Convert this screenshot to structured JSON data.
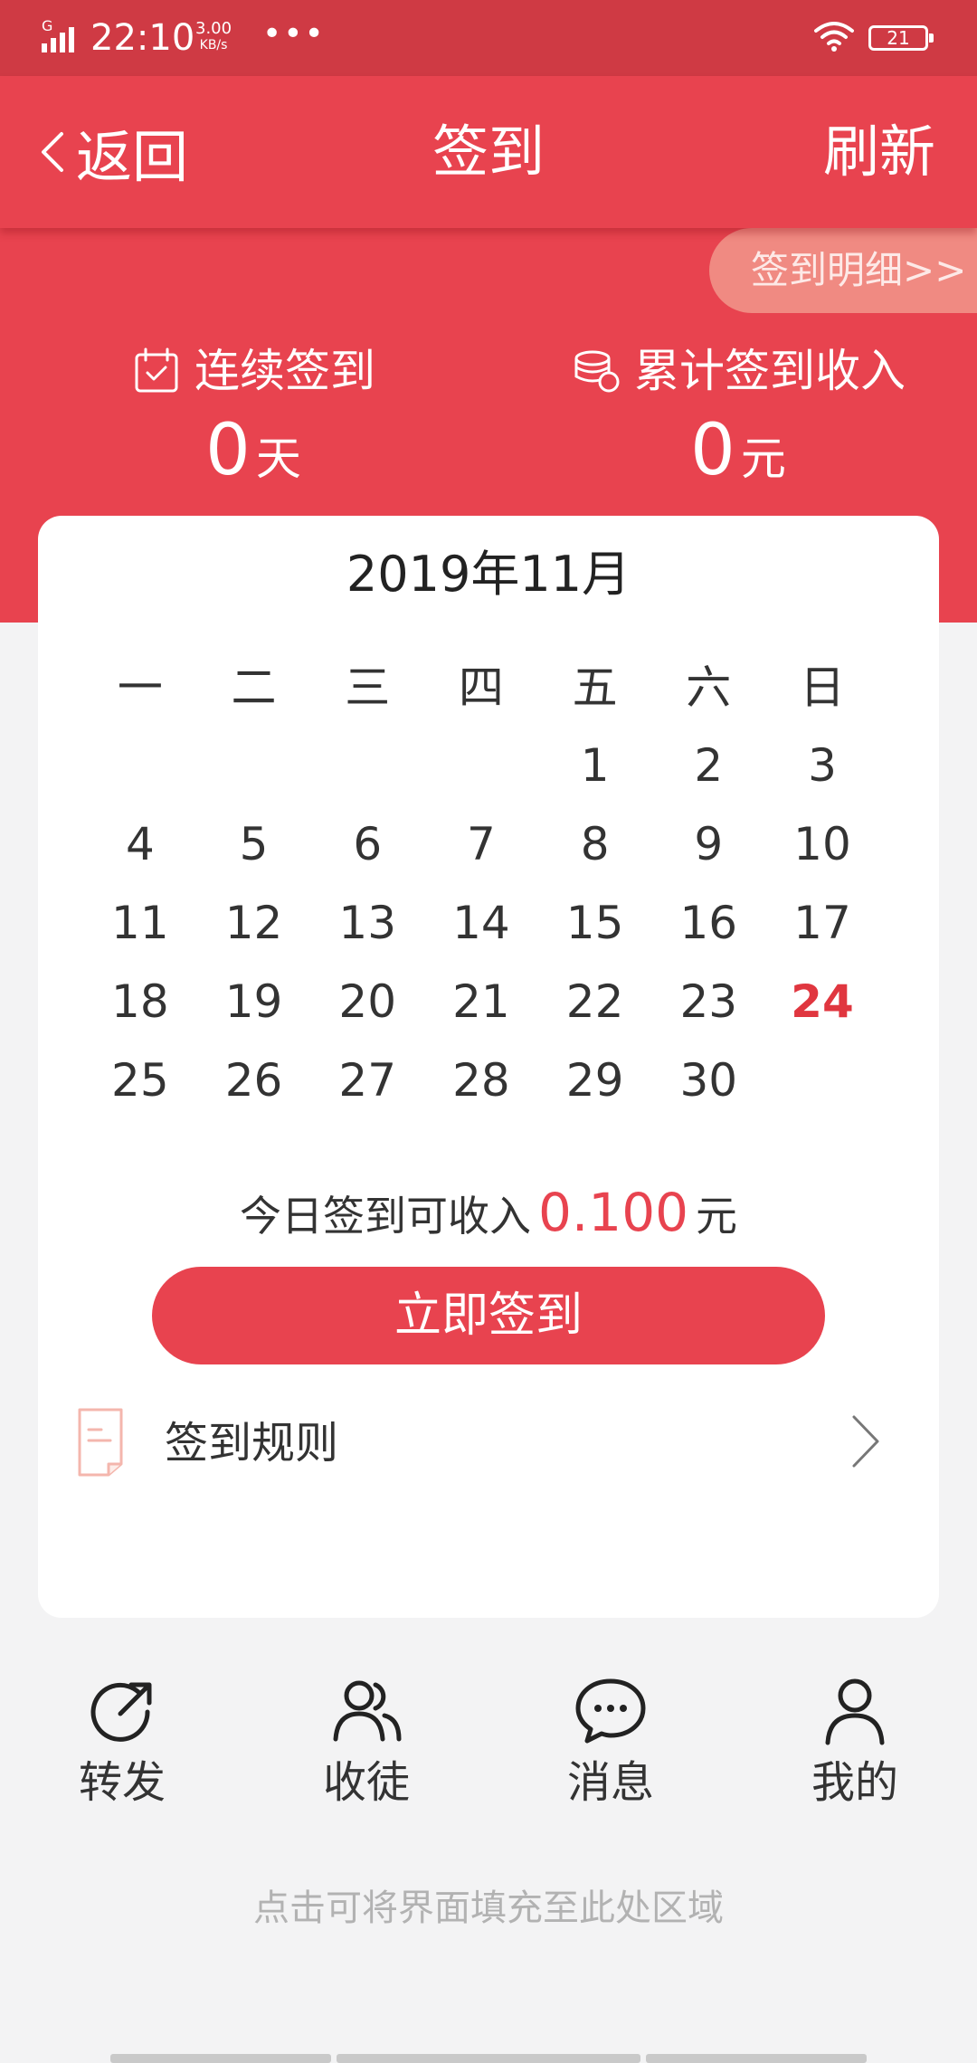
{
  "status_bar": {
    "network": "G",
    "time": "22:10",
    "speed_value": "3.00",
    "speed_unit": "KB/s",
    "more": "•••",
    "battery": "21"
  },
  "nav": {
    "back_label": "返回",
    "title": "签到",
    "refresh_label": "刷新"
  },
  "hero": {
    "detail_link": "签到明细>>",
    "streak_label": "连续签到",
    "streak_value": "0",
    "streak_unit": "天",
    "total_label": "累计签到收入",
    "total_value": "0",
    "total_unit": "元"
  },
  "calendar": {
    "month_title": "2019年11月",
    "weekdays": [
      "一",
      "二",
      "三",
      "四",
      "五",
      "六",
      "日"
    ],
    "weeks": [
      [
        "",
        "",
        "",
        "",
        "1",
        "2",
        "3"
      ],
      [
        "4",
        "5",
        "6",
        "7",
        "8",
        "9",
        "10"
      ],
      [
        "11",
        "12",
        "13",
        "14",
        "15",
        "16",
        "17"
      ],
      [
        "18",
        "19",
        "20",
        "21",
        "22",
        "23",
        "24"
      ],
      [
        "25",
        "26",
        "27",
        "28",
        "29",
        "30",
        ""
      ]
    ],
    "today": "24"
  },
  "income": {
    "prefix": "今日签到可收入",
    "amount": "0.100",
    "unit": "元"
  },
  "signin_button": "立即签到",
  "rules_label": "签到规则",
  "tabs": [
    {
      "label": "转发",
      "icon": "share-icon"
    },
    {
      "label": "收徒",
      "icon": "users-icon"
    },
    {
      "label": "消息",
      "icon": "message-icon"
    },
    {
      "label": "我的",
      "icon": "person-icon"
    }
  ],
  "fill_hint": "点击可将界面填充至此处区域",
  "colors": {
    "primary": "#e8434f",
    "status_bar": "#cf3a44",
    "pill": "#f08a82",
    "today_highlight": "#e0363f",
    "background": "#f3f3f4"
  }
}
